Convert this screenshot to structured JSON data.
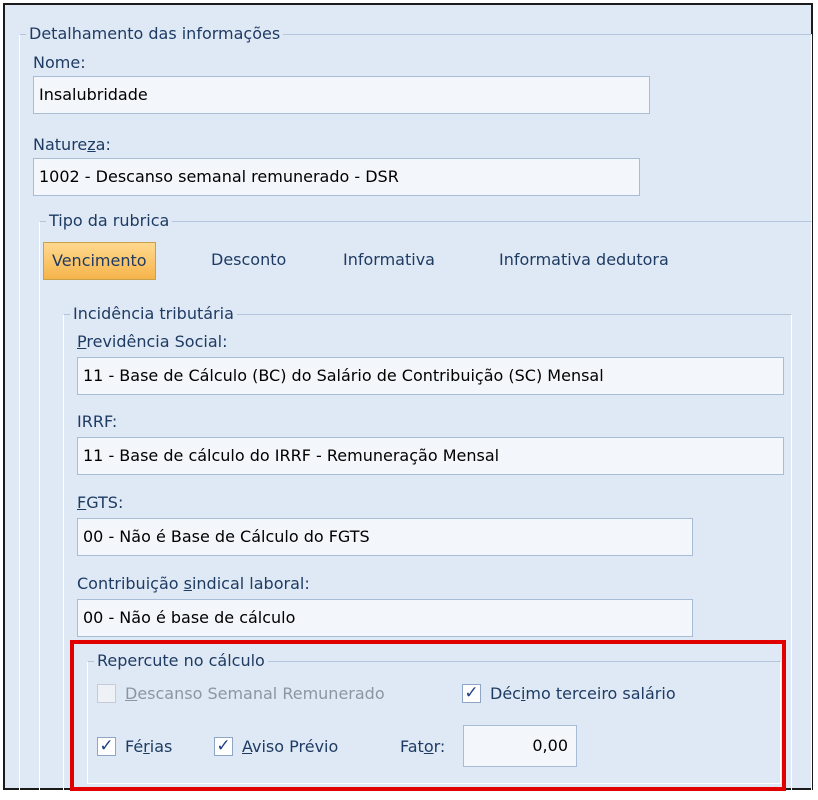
{
  "group_title": "Detalhamento das informações",
  "nome": {
    "label": "Nome:",
    "value": "Insalubridade"
  },
  "natureza": {
    "label_pre": "Nature",
    "label_u": "z",
    "label_post": "a:",
    "value": "1002 - Descanso semanal remunerado - DSR"
  },
  "tipo": {
    "title": "Tipo da rubrica",
    "tabs": [
      "Vencimento",
      "Desconto",
      "Informativa",
      "Informativa dedutora"
    ],
    "active": "Vencimento"
  },
  "incidencia": {
    "title": "Incidência tributária",
    "previdencia": {
      "label_u": "P",
      "label_post": "revidência Social:",
      "value": "11 - Base de Cálculo (BC) do Salário de Contribuição (SC) Mensal"
    },
    "irrf": {
      "label": "IRRF:",
      "value": "11 - Base de cálculo do IRRF - Remuneração Mensal"
    },
    "fgts": {
      "label_u": "F",
      "label_post": "GTS:",
      "value": "00 - Não é Base de Cálculo do FGTS"
    },
    "sindical": {
      "label_pre": "Contribuição ",
      "label_u": "s",
      "label_post": "indical laboral:",
      "value": "00 - Não é base de cálculo"
    }
  },
  "repercute": {
    "title": "Repercute no cálculo",
    "dsr": {
      "label_u": "D",
      "label_post": "escanso Semanal Remunerado",
      "checked": false
    },
    "decimo": {
      "label_pre": "Déc",
      "label_u": "i",
      "label_post": "mo terceiro salário",
      "checked": true
    },
    "ferias": {
      "label_pre": "Fé",
      "label_u": "r",
      "label_post": "ias",
      "checked": true
    },
    "aviso": {
      "label_u": "A",
      "label_post": "viso Prévio",
      "checked": true
    },
    "fator": {
      "label_pre": "Fat",
      "label_u": "o",
      "label_post": "r:",
      "value": "0,00"
    }
  },
  "check_glyph": "✓",
  "colors": {
    "highlight": "#e00000",
    "active_tab": "#f6b54b",
    "panel_bg": "#dfe9f5"
  }
}
